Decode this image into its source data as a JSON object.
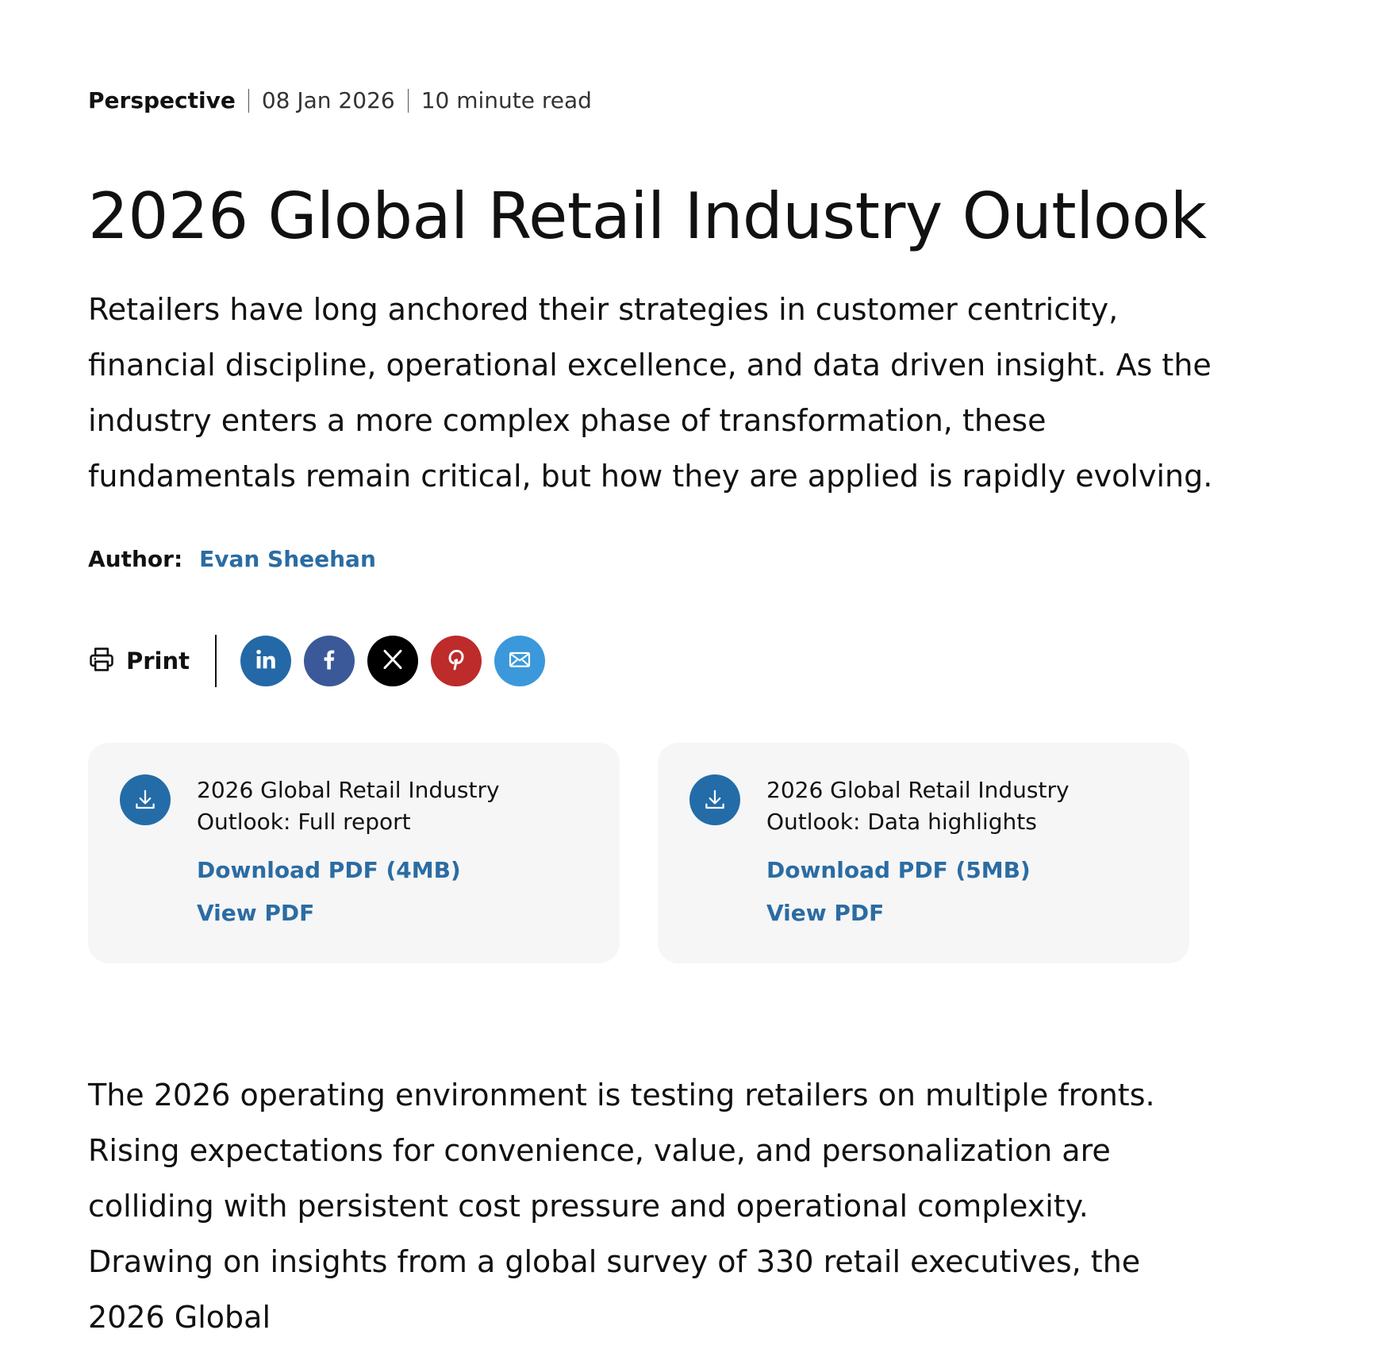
{
  "meta": {
    "type": "Perspective",
    "date": "08 Jan 2026",
    "read_time": "10 minute read"
  },
  "title": "2026 Global Retail Industry Outlook",
  "lead": "Retailers have long anchored their strategies in customer centricity, financial discipline, operational excellence, and data driven insight. As the industry enters a more complex phase of transformation, these fundamentals remain critical, but how they are applied is rapidly evolving.",
  "author": {
    "label": "Author:",
    "name": "Evan Sheehan"
  },
  "share": {
    "print_label": "Print",
    "print_icon": "printer-icon",
    "icons": {
      "linkedin": "linkedin-icon",
      "facebook": "facebook-icon",
      "x": "x-icon",
      "pinterest": "pinterest-icon",
      "email": "email-icon"
    },
    "colors": {
      "linkedin": "#2468a7",
      "facebook": "#3b5998",
      "x": "#000000",
      "pinterest": "#bd2b2b",
      "email": "#3b98da"
    }
  },
  "downloads": [
    {
      "title": "2026 Global Retail Industry Outlook: Full report",
      "download_label": "Download PDF (4MB)",
      "view_label": "View PDF",
      "icon": "download-icon"
    },
    {
      "title": "2026 Global Retail Industry Outlook: Data highlights",
      "download_label": "Download PDF (5MB)",
      "view_label": "View PDF",
      "icon": "download-icon"
    }
  ],
  "body": "The 2026 operating environment is testing retailers on multiple fronts. Rising expectations for convenience, value, and personalization are colliding with persistent cost pressure and operational complexity. Drawing on insights from a global survey of 330 retail executives, the 2026 Global",
  "colors": {
    "link": "#2b6ca3",
    "accent": "#236ca8",
    "card_bg": "#f6f6f6",
    "text": "#111111"
  }
}
